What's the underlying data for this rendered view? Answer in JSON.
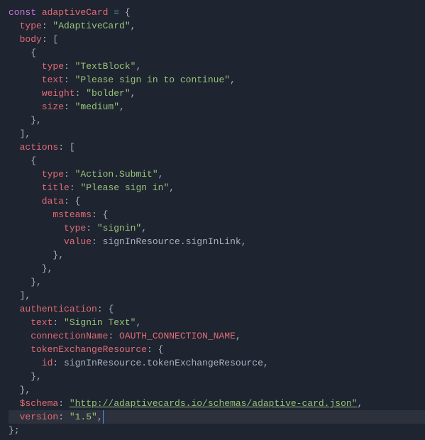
{
  "code": {
    "l1": {
      "kw": "const",
      "var": " adaptiveCard ",
      "op": "= ",
      "brace": "{"
    },
    "l2": {
      "prop": "  type",
      "colon": ": ",
      "str": "\"AdaptiveCard\"",
      "comma": ","
    },
    "l3": {
      "prop": "  body",
      "colon": ": ",
      "bracket": "["
    },
    "l4": {
      "brace": "    {"
    },
    "l5": {
      "prop": "      type",
      "colon": ": ",
      "str": "\"TextBlock\"",
      "comma": ","
    },
    "l6": {
      "prop": "      text",
      "colon": ": ",
      "str": "\"Please sign in to continue\"",
      "comma": ","
    },
    "l7": {
      "prop": "      weight",
      "colon": ": ",
      "str": "\"bolder\"",
      "comma": ","
    },
    "l8": {
      "prop": "      size",
      "colon": ": ",
      "str": "\"medium\"",
      "comma": ","
    },
    "l9": {
      "brace": "    }",
      "comma": ","
    },
    "l10": {
      "bracket": "  ]",
      "comma": ","
    },
    "l11": {
      "prop": "  actions",
      "colon": ": ",
      "bracket": "["
    },
    "l12": {
      "brace": "    {"
    },
    "l13": {
      "prop": "      type",
      "colon": ": ",
      "str": "\"Action.Submit\"",
      "comma": ","
    },
    "l14": {
      "prop": "      title",
      "colon": ": ",
      "str": "\"Please sign in\"",
      "comma": ","
    },
    "l15": {
      "prop": "      data",
      "colon": ": ",
      "brace": "{"
    },
    "l16": {
      "prop": "        msteams",
      "colon": ": ",
      "brace": "{"
    },
    "l17": {
      "prop": "          type",
      "colon": ": ",
      "str": "\"signin\"",
      "comma": ","
    },
    "l18": {
      "prop": "          value",
      "colon": ": ",
      "ident1": "signInResource",
      "dot": ".",
      "ident2": "signInLink",
      "comma": ","
    },
    "l19": {
      "brace": "        }",
      "comma": ","
    },
    "l20": {
      "brace": "      }",
      "comma": ","
    },
    "l21": {
      "brace": "    }",
      "comma": ","
    },
    "l22": {
      "bracket": "  ]",
      "comma": ","
    },
    "l23": {
      "prop": "  authentication",
      "colon": ": ",
      "brace": "{"
    },
    "l24": {
      "prop": "    text",
      "colon": ": ",
      "str": "\"Signin Text\"",
      "comma": ","
    },
    "l25": {
      "prop": "    connectionName",
      "colon": ": ",
      "const": "OAUTH_CONNECTION_NAME",
      "comma": ","
    },
    "l26": {
      "prop": "    tokenExchangeResource",
      "colon": ": ",
      "brace": "{"
    },
    "l27": {
      "prop": "      id",
      "colon": ": ",
      "ident1": "signInResource",
      "dot": ".",
      "ident2": "tokenExchangeResource",
      "comma": ","
    },
    "l28": {
      "brace": "    }",
      "comma": ","
    },
    "l29": {
      "brace": "  }",
      "comma": ","
    },
    "l30": {
      "prop": "  $schema",
      "colon": ": ",
      "str": "\"http://adaptivecards.io/schemas/adaptive-card.json\"",
      "comma": ","
    },
    "l31": {
      "prop": "  version",
      "colon": ": ",
      "str": "\"1.5\"",
      "comma": ","
    },
    "l32": {
      "brace": "}",
      "semi": ";"
    }
  }
}
